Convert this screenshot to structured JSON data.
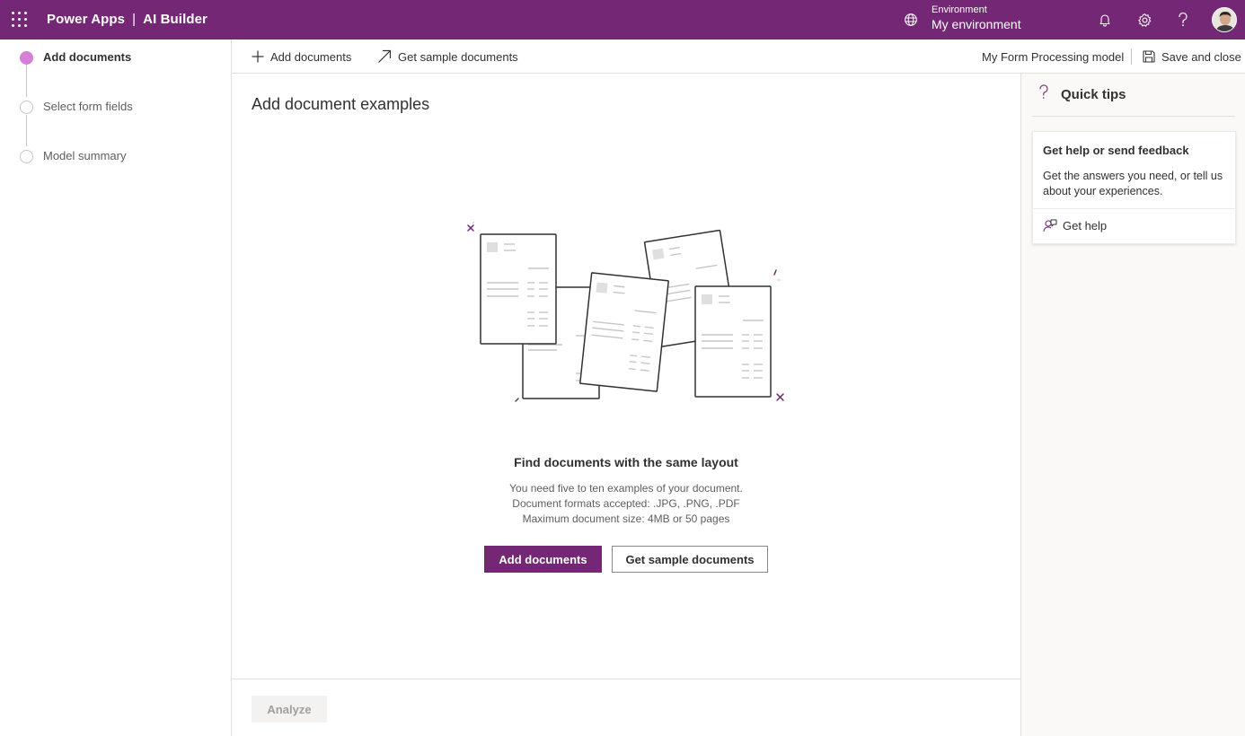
{
  "app": {
    "product": "Power Apps",
    "separator": "|",
    "module": "AI Builder"
  },
  "environment": {
    "label": "Environment",
    "name": "My environment"
  },
  "top_icons": [
    "waffle-icon",
    "globe-icon",
    "bell-icon",
    "gear-icon",
    "help-icon",
    "avatar"
  ],
  "steps": [
    {
      "label": "Add documents",
      "active": true
    },
    {
      "label": "Select form fields",
      "active": false
    },
    {
      "label": "Model summary",
      "active": false
    }
  ],
  "commands": {
    "add_documents": "Add documents",
    "get_sample_documents": "Get sample documents",
    "model_name": "My Form Processing model",
    "save_and_close": "Save and close"
  },
  "main": {
    "title": "Add document examples",
    "empty_title": "Find documents with the same layout",
    "empty_lines": [
      "You need five to ten examples of your document.",
      "Document formats accepted: .JPG, .PNG, .PDF",
      "Maximum document size: 4MB or 50 pages"
    ],
    "primary_button": "Add documents",
    "secondary_button": "Get sample documents"
  },
  "footer": {
    "analyze_button": "Analyze",
    "analyze_enabled": false
  },
  "quick_tips": {
    "title": "Quick tips",
    "card_title": "Get help or send feedback",
    "card_body": "Get the answers you need, or tell us about your experiences.",
    "link_label": "Get help"
  },
  "colors": {
    "brand": "#742774",
    "active_step": "#d67fd6",
    "panel_bg": "#faf9f8"
  }
}
